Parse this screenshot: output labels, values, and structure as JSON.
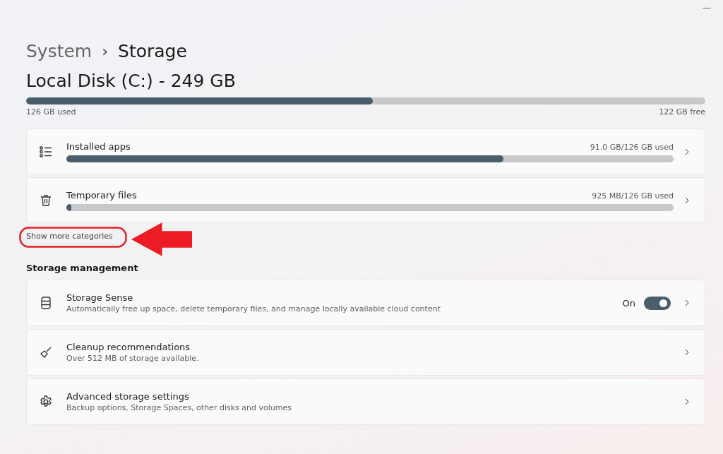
{
  "window": {
    "minimize": "—"
  },
  "breadcrumb": {
    "parent": "System",
    "separator": "›",
    "current": "Storage"
  },
  "disk": {
    "title": "Local Disk (C:) - 249 GB",
    "level": 0.51,
    "used": "126 GB used",
    "free": "122 GB free"
  },
  "categories": [
    {
      "name": "Installed apps",
      "usage": "91.0 GB/126 GB used",
      "level": 0.72
    },
    {
      "name": "Temporary files",
      "usage": "925 MB/126 GB used",
      "level": 0.008
    }
  ],
  "show_more": "Show more categories",
  "management": {
    "heading": "Storage management",
    "items": [
      {
        "kind": "toggle",
        "title": "Storage Sense",
        "subtitle": "Automatically free up space, delete temporary files, and manage locally available cloud content",
        "state_label": "On",
        "on": true
      },
      {
        "kind": "link",
        "title": "Cleanup recommendations",
        "subtitle": "Over 512 MB of storage available."
      },
      {
        "kind": "link",
        "title": "Advanced storage settings",
        "subtitle": "Backup options, Storage Spaces, other disks and volumes"
      }
    ]
  }
}
